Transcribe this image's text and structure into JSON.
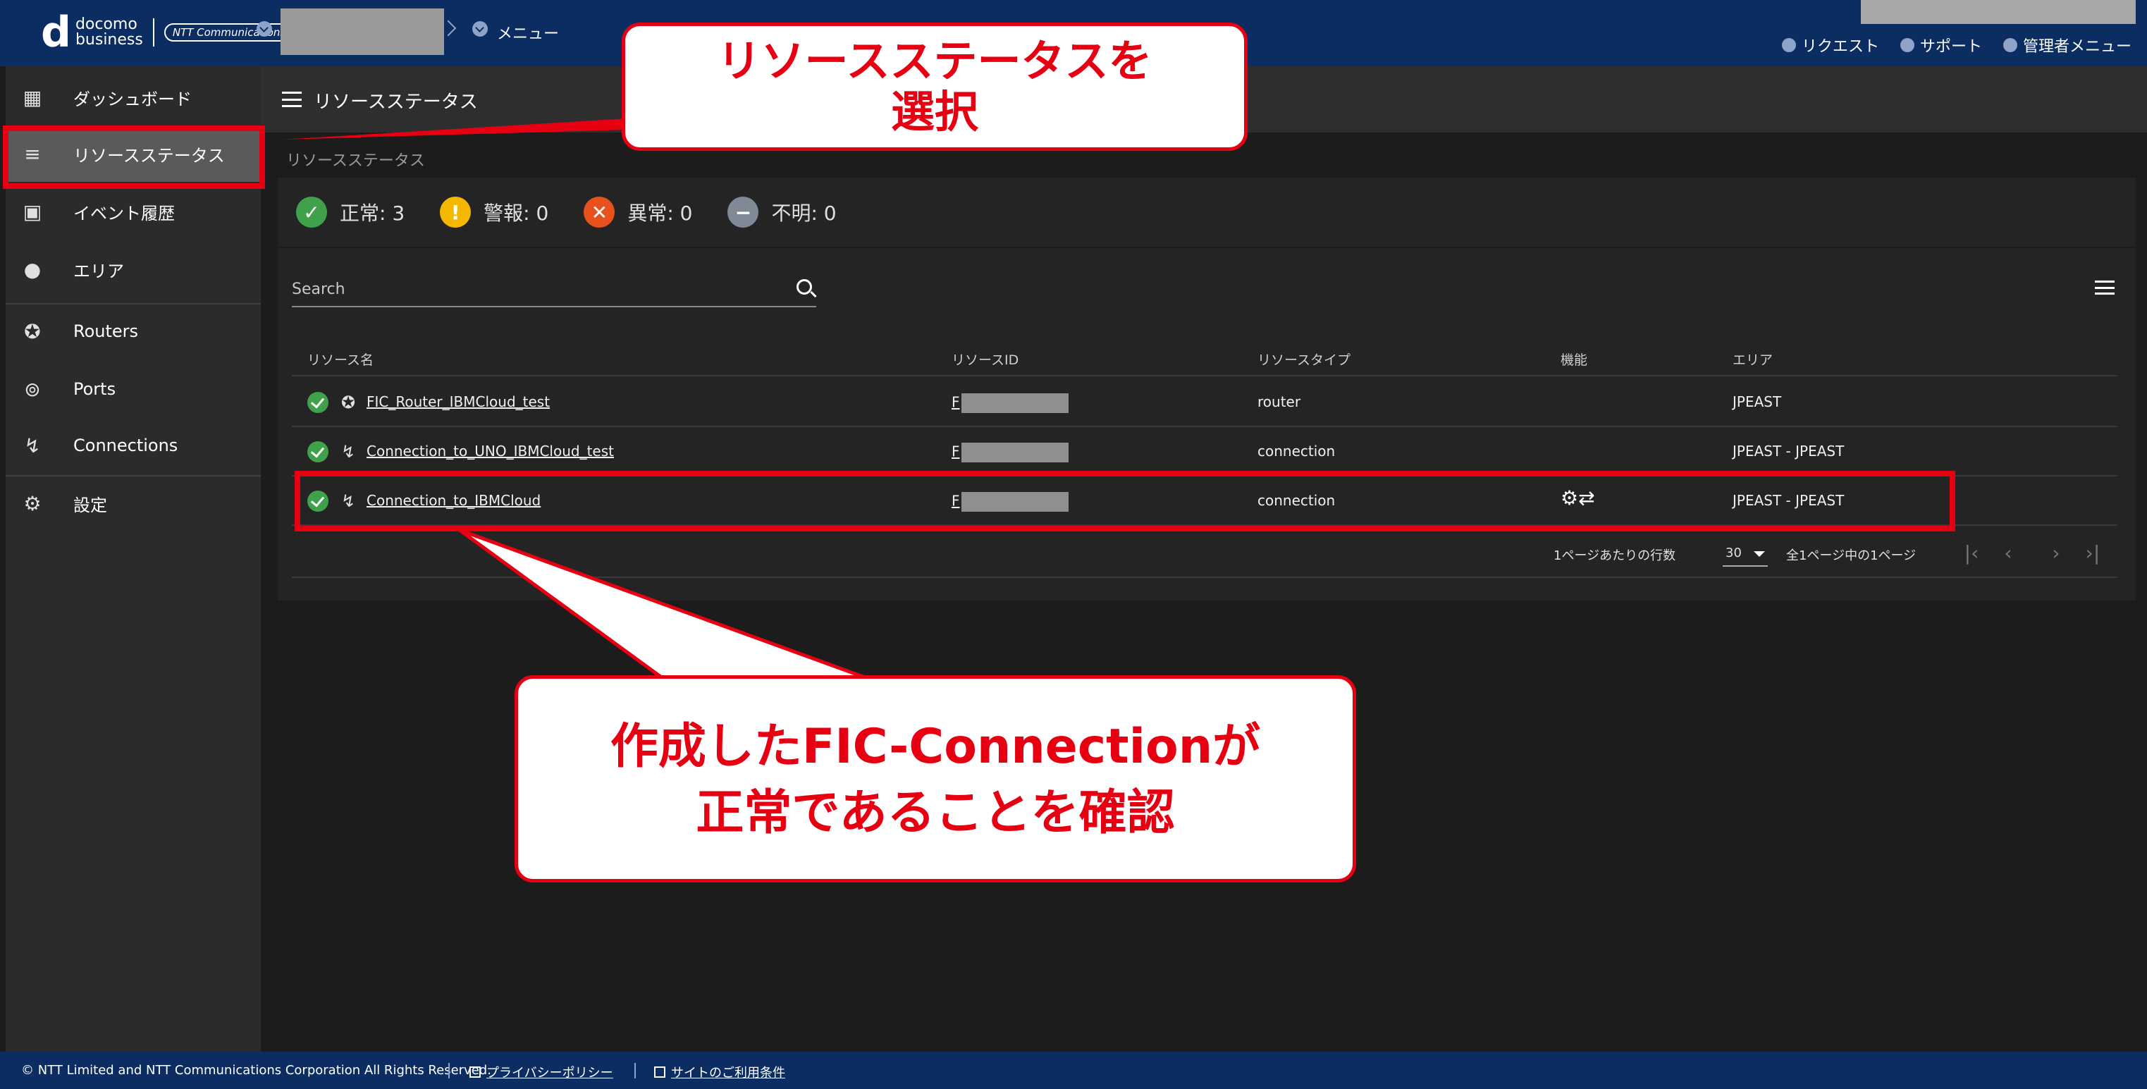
{
  "header": {
    "logo_mark": "d",
    "logo_line1": "docomo",
    "logo_line2": "business",
    "logo_partner": "NTT Communications",
    "menu_label": "メニュー",
    "links": [
      {
        "label": "リクエスト",
        "icon": "bell-icon"
      },
      {
        "label": "サポート",
        "icon": "help-icon"
      },
      {
        "label": "管理者メニュー",
        "icon": "gear-icon"
      }
    ]
  },
  "sidebar": {
    "items": [
      {
        "label": "ダッシュボード",
        "icon": "grid-icon"
      },
      {
        "label": "リソースステータス",
        "icon": "status-list-icon",
        "active": true
      },
      {
        "label": "イベント履歴",
        "icon": "calendar-check-icon"
      },
      {
        "label": "エリア",
        "icon": "globe-pin-icon"
      },
      {
        "label": "Routers",
        "icon": "router-icon"
      },
      {
        "label": "Ports",
        "icon": "port-icon"
      },
      {
        "label": "Connections",
        "icon": "connection-icon"
      },
      {
        "label": "設定",
        "icon": "gear-icon"
      }
    ]
  },
  "page": {
    "title": "リソースステータス",
    "breadcrumb": "リソースステータス"
  },
  "status_summary": [
    {
      "label": "正常: 3",
      "color": "#3fa14a",
      "icon": "check-circle-icon",
      "glyph": "✓"
    },
    {
      "label": "警報: 0",
      "color": "#f5b800",
      "icon": "warning-circle-icon",
      "glyph": "!"
    },
    {
      "label": "異常: 0",
      "color": "#e8501e",
      "icon": "error-circle-icon",
      "glyph": "✕"
    },
    {
      "label": "不明: 0",
      "color": "#7f8a96",
      "icon": "unknown-circle-icon",
      "glyph": "−"
    }
  ],
  "search": {
    "placeholder": "Search"
  },
  "table": {
    "headers": [
      "リソース名",
      "リソースID",
      "リソースタイプ",
      "機能",
      "エリア"
    ],
    "rows": [
      {
        "name": "FIC_Router_IBMCloud_test",
        "id_prefix": "F",
        "type": "router",
        "function": "",
        "area": "JPEAST",
        "icon": "router-icon"
      },
      {
        "name": "Connection_to_UNO_IBMCloud_test",
        "id_prefix": "F",
        "type": "connection",
        "function": "",
        "area": "JPEAST - JPEAST",
        "icon": "connection-icon"
      },
      {
        "name": "Connection_to_IBMCloud",
        "id_prefix": "F",
        "type": "connection",
        "function": "⚙⇄",
        "area": "JPEAST - JPEAST",
        "icon": "connection-icon"
      }
    ]
  },
  "pagination": {
    "rows_label": "1ページあたりの行数",
    "rows_value": "30",
    "range_text": "全1ページ中の1ページ"
  },
  "annotations": {
    "callout1": [
      "リソースステータスを",
      "選択"
    ],
    "callout2": [
      "作成したFIC-Connectionが",
      "正常であることを確認"
    ],
    "accent": "#e60012"
  },
  "footer": {
    "copyright": "© NTT Limited and NTT Communications Corporation All Rights Reserved.",
    "privacy": "プライバシーポリシー",
    "terms": "サイトのご利用条件"
  }
}
